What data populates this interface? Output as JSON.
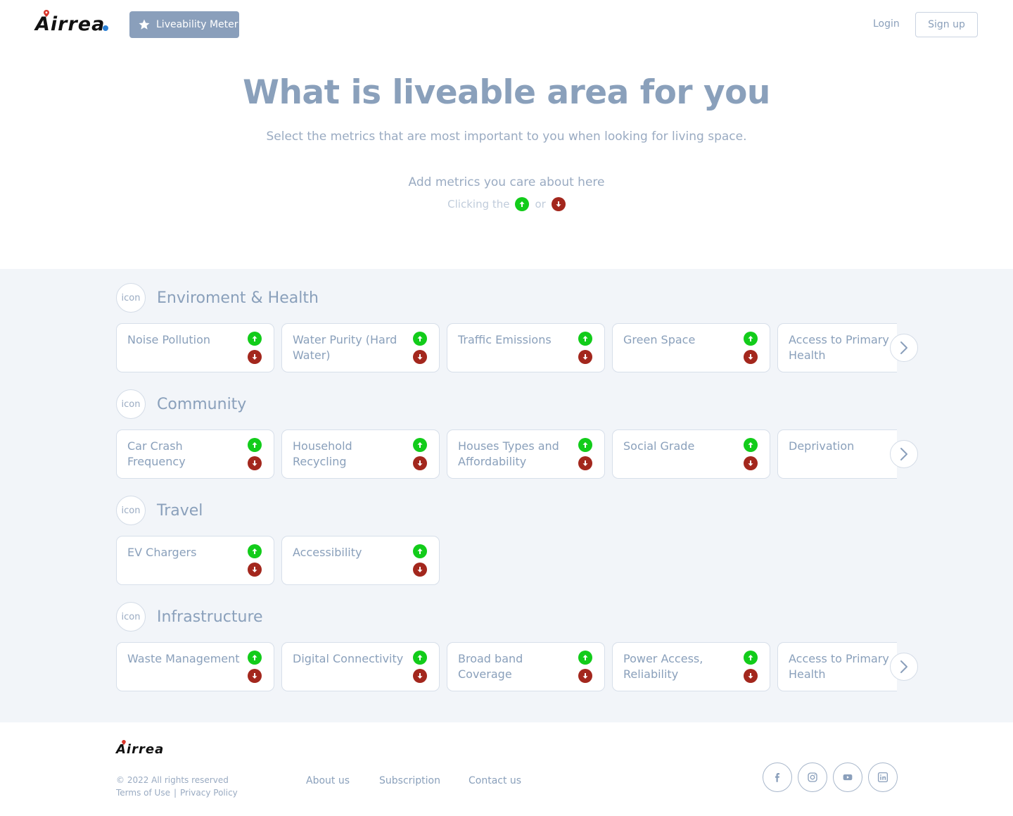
{
  "header": {
    "logo_text": "Airrea",
    "liveability_button": "Liveability Meter",
    "login": "Login",
    "signup": "Sign up"
  },
  "hero": {
    "title": "What is liveable area for you",
    "subtitle": "Select the metrics that are most important to you when looking for living space.",
    "add_metrics": "Add metrics you care about here",
    "clicking_prefix": "Clicking the",
    "clicking_or": "or"
  },
  "categories": [
    {
      "icon_text": "icon",
      "title": "Enviroment & Health",
      "items": [
        "Noise Pollution",
        "Water Purity (Hard Water)",
        "Traffic Emissions",
        "Green Space",
        "Access to Primary Health"
      ]
    },
    {
      "icon_text": "icon",
      "title": "Community",
      "items": [
        "Car Crash Frequency",
        "Household Recycling",
        "Houses Types and Affordability",
        "Social Grade",
        "Deprivation"
      ]
    },
    {
      "icon_text": "icon",
      "title": "Travel",
      "items": [
        "EV Chargers",
        "Accessibility"
      ]
    },
    {
      "icon_text": "icon",
      "title": "Infrastructure",
      "items": [
        "Waste Management",
        "Digital Connectivity",
        "Broad band Coverage",
        "Power Access, Reliability",
        "Access to Primary Health"
      ]
    }
  ],
  "footer": {
    "logo_text": "Airrea",
    "copyright": "© 2022 All rights reserved",
    "terms": "Terms of Use",
    "separator": "|",
    "privacy": "Privacy Policy",
    "nav": [
      "About us",
      "Subscription",
      "Contact us"
    ]
  },
  "icons": {
    "star": "star-icon",
    "up": "arrow-up-icon",
    "down": "arrow-down-icon",
    "next": "chevron-right-icon",
    "social": [
      "facebook-icon",
      "instagram-icon",
      "youtube-icon",
      "linkedin-icon"
    ]
  },
  "colors": {
    "accent": "#8a9fbb",
    "up": "#12cc1a",
    "down": "#a3271d",
    "section_bg": "#f2f5f9"
  }
}
